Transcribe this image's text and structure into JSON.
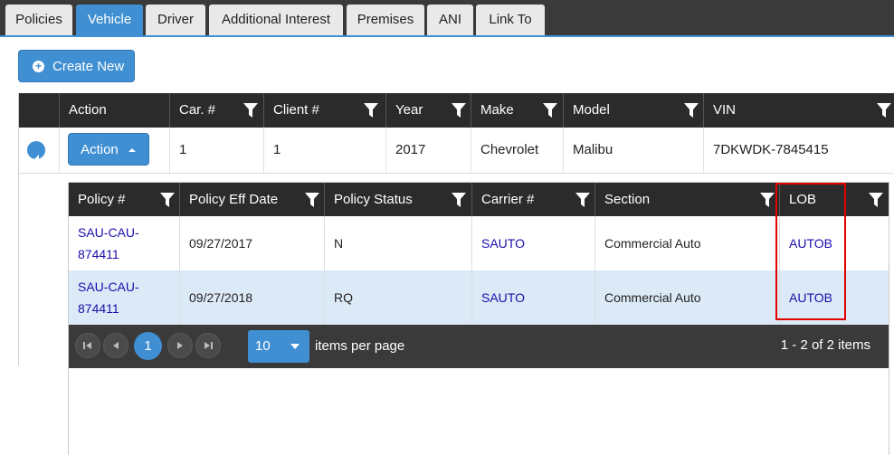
{
  "tabs": [
    {
      "label": "Policies",
      "active": false
    },
    {
      "label": "Vehicle",
      "active": true
    },
    {
      "label": "Driver",
      "active": false
    },
    {
      "label": "Additional Interest",
      "active": false
    },
    {
      "label": "Premises",
      "active": false
    },
    {
      "label": "ANI",
      "active": false
    },
    {
      "label": "Link To",
      "active": false
    }
  ],
  "toolbar": {
    "create_new_label": "Create New"
  },
  "vehicle_grid": {
    "columns": [
      "Action",
      "Car. #",
      "Client #",
      "Year",
      "Make",
      "Model",
      "VIN"
    ],
    "row": {
      "action_label": "Action",
      "car": "1",
      "client": "1",
      "year": "2017",
      "make": "Chevrolet",
      "model": "Malibu",
      "vin": "7DKWDK-7845415"
    }
  },
  "policy_grid": {
    "columns": [
      "Policy #",
      "Policy Eff Date",
      "Policy Status",
      "Carrier #",
      "Section",
      "LOB"
    ],
    "rows": [
      {
        "policy_line1": "SAU-CAU-",
        "policy_line2": "874411",
        "eff_date": "09/27/2017",
        "status": "N",
        "carrier": "SAUTO",
        "section": "Commercial Auto",
        "lob": "AUTOB"
      },
      {
        "policy_line1": "SAU-CAU-",
        "policy_line2": "874411",
        "eff_date": "09/27/2018",
        "status": "RQ",
        "carrier": "SAUTO",
        "section": "Commercial Auto",
        "lob": "AUTOB"
      }
    ],
    "pager": {
      "current_page": "1",
      "page_size": "10",
      "items_per_page_label": "items per page",
      "info": "1 - 2 of 2 items"
    }
  },
  "colors": {
    "accent": "#3f8fd2",
    "header": "#2b2b2b",
    "highlight": "#e00000",
    "alt_row": "#dce9f7"
  }
}
